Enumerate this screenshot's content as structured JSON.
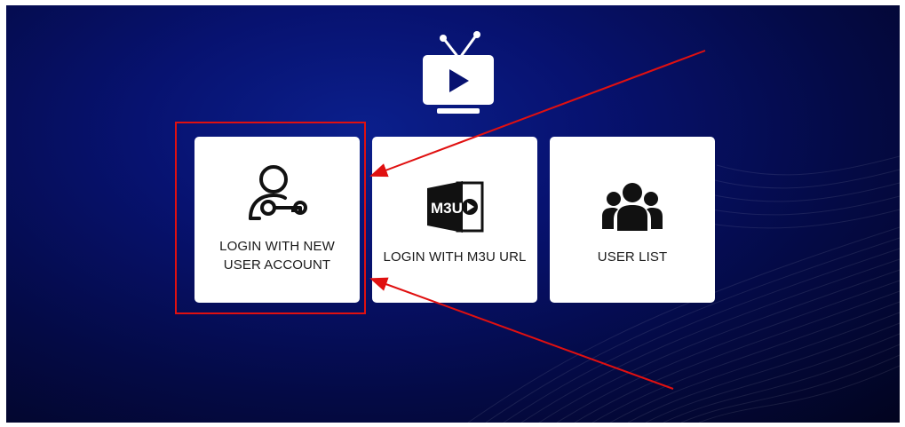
{
  "screen": {
    "background_color": "#040a45",
    "accent_color": "#e01010"
  },
  "logo": {
    "icon": "tv-play-icon"
  },
  "cards": [
    {
      "id": "new_user",
      "label": "LOGIN WITH NEW USER ACCOUNT",
      "icon": "user-key-icon"
    },
    {
      "id": "m3u",
      "label": "LOGIN WITH M3U URL",
      "icon": "m3u-file-icon",
      "icon_text": "M3U"
    },
    {
      "id": "user_list",
      "label": "USER LIST",
      "icon": "users-group-icon"
    }
  ],
  "annotation": {
    "highlight_color": "#e01010",
    "highlight_target": "LOGIN WITH NEW USER ACCOUNT"
  }
}
